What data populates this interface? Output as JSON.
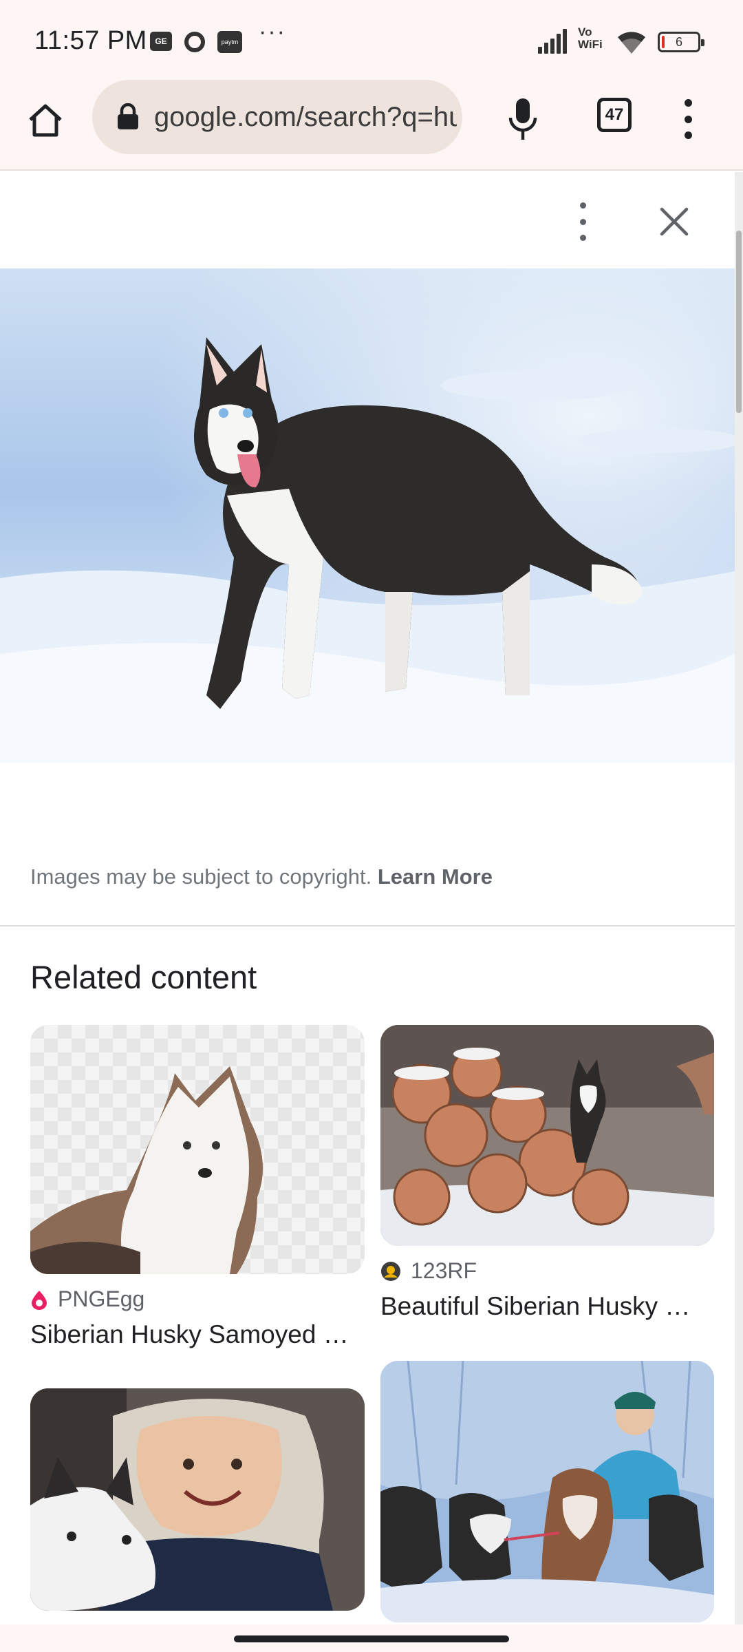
{
  "status_bar": {
    "time": "11:57 PM",
    "network_label": "Vo\nWiFi",
    "battery_level": "6",
    "icons": [
      "gallery-badge-icon",
      "opera-icon",
      "paytm-icon",
      "more-notifications-icon",
      "signal-icon",
      "wifi-icon",
      "battery-icon"
    ],
    "paytm_label": "paytm",
    "badge_label": "GE"
  },
  "toolbar": {
    "url": "google.com/search?q=husky",
    "tab_count": "47",
    "icons": [
      "home-icon",
      "lock-icon",
      "mic-icon",
      "tab-switcher-icon",
      "overflow-menu-icon"
    ]
  },
  "viewer": {
    "icons": [
      "more-vert-icon",
      "close-icon"
    ],
    "copyright_text": "Images may be subject to copyright. ",
    "learn_more": "Learn More"
  },
  "related": {
    "heading": "Related content",
    "cards": [
      {
        "source": "PNGEgg",
        "title": "Siberian Husky Samoyed …"
      },
      {
        "source": "123RF",
        "title": "Beautiful Siberian Husky …"
      },
      {
        "source": "",
        "title": ""
      },
      {
        "source": "",
        "title": ""
      }
    ]
  },
  "colors": {
    "chrome_bg": "#fdf6f4",
    "url_pill": "#efe3de",
    "pngegg_pink": "#e91e63",
    "text_primary": "#202124",
    "text_secondary": "#5f6368"
  }
}
